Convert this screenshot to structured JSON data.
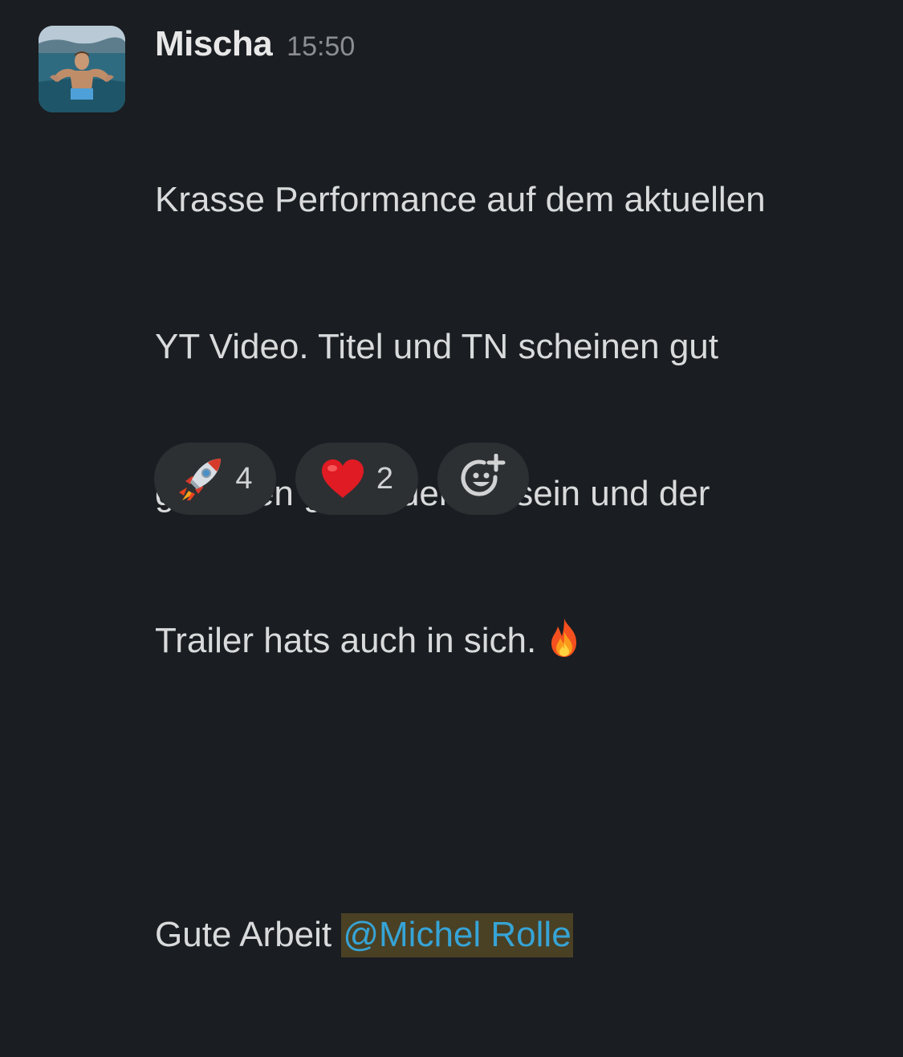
{
  "message": {
    "author": "Mischa",
    "timestamp": "15:50",
    "text_line_1": "Krasse Performance auf dem aktuellen",
    "text_line_2": "YT Video. Titel und TN scheinen gut",
    "text_line_3": "getroffen geworden zu sein und der",
    "text_line_4": "Trailer hats auch in sich.",
    "text_line_5": "Gute Arbeit ",
    "mention": "@Michel Rolle"
  },
  "reactions": [
    {
      "icon": "rocket-emoji",
      "count": "4"
    },
    {
      "icon": "heart-emoji",
      "count": "2"
    },
    {
      "icon": "add-reaction-icon"
    }
  ],
  "colors": {
    "background": "#1a1d21",
    "mention_text": "#36a4d6",
    "mention_bg": "#4a4024",
    "reaction_bg": "#2d3033"
  }
}
